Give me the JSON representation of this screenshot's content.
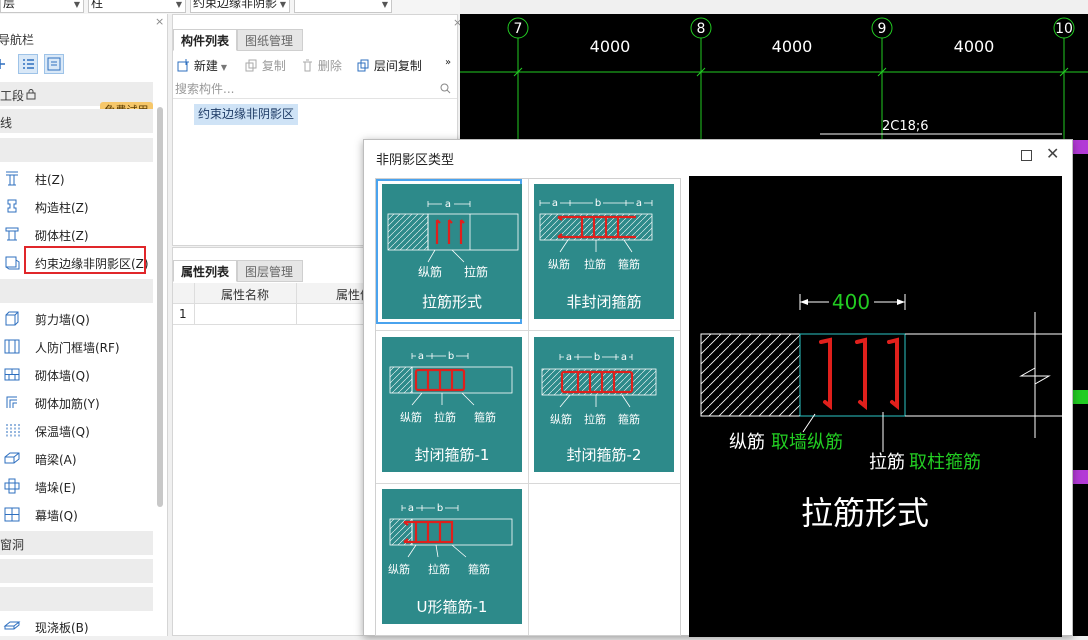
{
  "toolbar": {
    "combo1": "层",
    "combo2": "柱",
    "combo3": "约束边缘非阴影",
    "combo4": ""
  },
  "nav": {
    "title": "导航栏",
    "close": "×",
    "groups": [
      "工段",
      "线",
      "",
      "",
      "窗洞",
      "",
      ""
    ],
    "badge": "免费试用",
    "lock_icon": "lock-icon",
    "items": [
      {
        "label": "柱(Z)",
        "icon": "column-icon"
      },
      {
        "label": "构造柱(Z)",
        "icon": "constructional-column-icon"
      },
      {
        "label": "砌体柱(Z)",
        "icon": "masonry-column-icon"
      },
      {
        "label": "约束边缘非阴影区(Z)",
        "icon": "boundary-zone-icon",
        "selected": true
      },
      {
        "label": "剪力墙(Q)",
        "icon": "shear-wall-icon"
      },
      {
        "label": "人防门框墙(RF)",
        "icon": "civil-defense-wall-icon"
      },
      {
        "label": "砌体墙(Q)",
        "icon": "masonry-wall-icon"
      },
      {
        "label": "砌体加筋(Y)",
        "icon": "masonry-reinforcement-icon"
      },
      {
        "label": "保温墙(Q)",
        "icon": "insulation-wall-icon"
      },
      {
        "label": "暗梁(A)",
        "icon": "hidden-beam-icon"
      },
      {
        "label": "墙垛(E)",
        "icon": "wall-pier-icon"
      },
      {
        "label": "幕墙(Q)",
        "icon": "curtain-wall-icon"
      },
      {
        "label": "现浇板(B)",
        "icon": "cast-slab-icon"
      }
    ]
  },
  "components": {
    "tab_list": "构件列表",
    "tab_drawing": "图纸管理",
    "new": "新建",
    "copy": "复制",
    "delete": "删除",
    "layer_copy": "层间复制",
    "more": "»",
    "search_placeholder": "搜索构件...",
    "selected_item": "约束边缘非阴影区"
  },
  "properties": {
    "tab_attr": "属性列表",
    "tab_layer": "图层管理",
    "col_name": "属性名称",
    "col_value": "属性值",
    "row1": "1"
  },
  "cad": {
    "axes": [
      "7",
      "8",
      "9",
      "10"
    ],
    "spans": [
      "4000",
      "4000",
      "4000"
    ],
    "annotation": "2C18;6"
  },
  "dialog": {
    "title": "非阴影区类型",
    "tiles": [
      {
        "caption": "拉筋形式",
        "dims": [
          "a"
        ],
        "labels": [
          "纵筋",
          "拉筋"
        ],
        "selected": true
      },
      {
        "caption": "非封闭箍筋",
        "dims": [
          "a",
          "b",
          "a"
        ],
        "labels": [
          "纵筋",
          "拉筋",
          "箍筋"
        ]
      },
      {
        "caption": "封闭箍筋-1",
        "dims": [
          "a",
          "b"
        ],
        "labels": [
          "纵筋",
          "拉筋",
          "箍筋"
        ]
      },
      {
        "caption": "封闭箍筋-2",
        "dims": [
          "a",
          "b",
          "a"
        ],
        "labels": [
          "纵筋",
          "拉筋",
          "箍筋"
        ]
      },
      {
        "caption": "U形箍筋-1",
        "dims": [
          "a",
          "b"
        ],
        "labels": [
          "纵筋",
          "拉筋",
          "箍筋"
        ]
      }
    ],
    "preview": {
      "dimension": "400",
      "label1": "纵筋",
      "label1_value": "取墙纵筋",
      "label2": "拉筋",
      "label2_value": "取柱箍筋",
      "caption": "拉筋形式"
    }
  },
  "colors": {
    "tile_bg": "#2d8a8a",
    "rebar_red": "#e0201c",
    "cad_green": "#22cc22",
    "selection_blue": "#4aa3ee"
  }
}
